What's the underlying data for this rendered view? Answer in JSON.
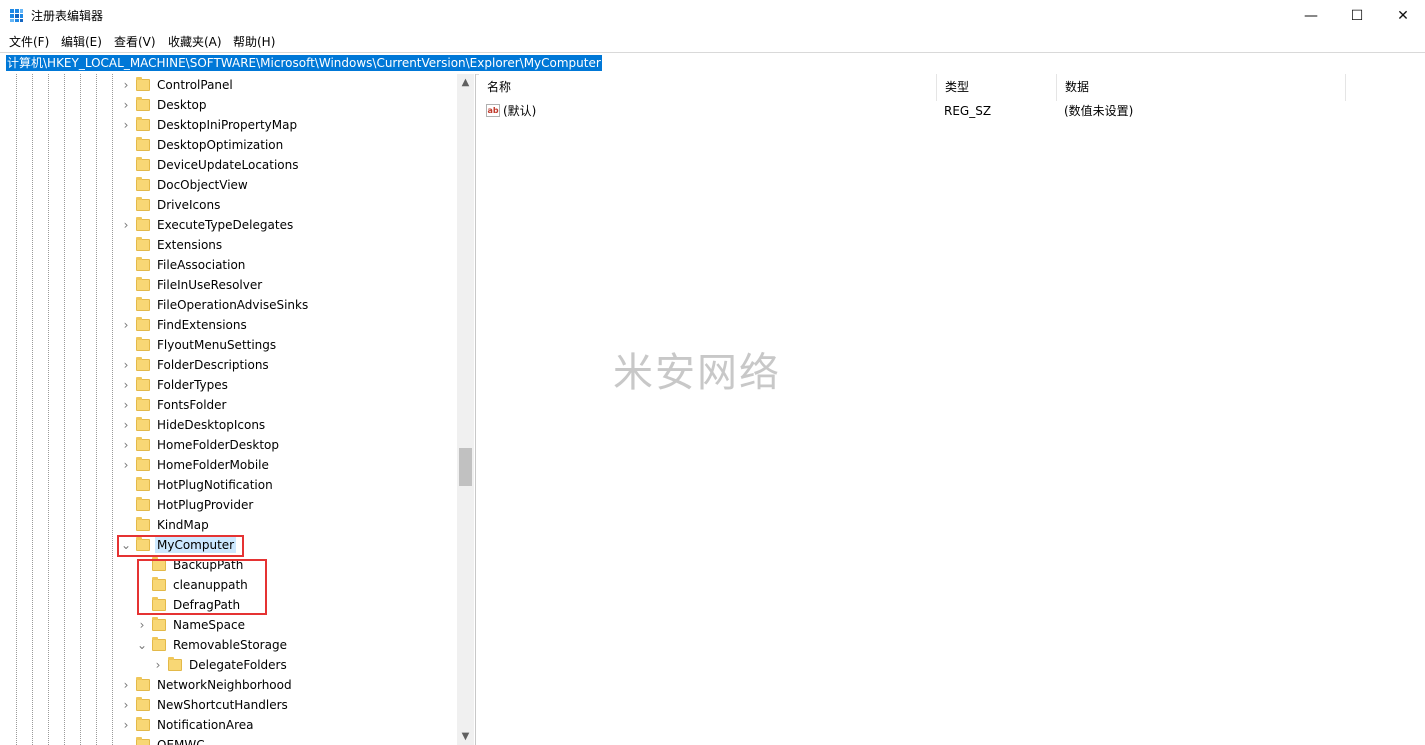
{
  "window": {
    "title": "注册表编辑器",
    "minimize": "—",
    "maximize": "☐",
    "close": "✕"
  },
  "menu": [
    "文件(F)",
    "编辑(E)",
    "查看(V)",
    "收藏夹(A)",
    "帮助(H)"
  ],
  "address": "计算机\\HKEY_LOCAL_MACHINE\\SOFTWARE\\Microsoft\\Windows\\CurrentVersion\\Explorer\\MyComputer",
  "tree": [
    {
      "label": "ControlPanel",
      "expander": "›"
    },
    {
      "label": "Desktop",
      "expander": "›"
    },
    {
      "label": "DesktopIniPropertyMap",
      "expander": "›"
    },
    {
      "label": "DesktopOptimization",
      "expander": ""
    },
    {
      "label": "DeviceUpdateLocations",
      "expander": ""
    },
    {
      "label": "DocObjectView",
      "expander": ""
    },
    {
      "label": "DriveIcons",
      "expander": ""
    },
    {
      "label": "ExecuteTypeDelegates",
      "expander": "›"
    },
    {
      "label": "Extensions",
      "expander": ""
    },
    {
      "label": "FileAssociation",
      "expander": ""
    },
    {
      "label": "FileInUseResolver",
      "expander": ""
    },
    {
      "label": "FileOperationAdviseSinks",
      "expander": ""
    },
    {
      "label": "FindExtensions",
      "expander": "›"
    },
    {
      "label": "FlyoutMenuSettings",
      "expander": ""
    },
    {
      "label": "FolderDescriptions",
      "expander": "›"
    },
    {
      "label": "FolderTypes",
      "expander": "›"
    },
    {
      "label": "FontsFolder",
      "expander": "›"
    },
    {
      "label": "HideDesktopIcons",
      "expander": "›"
    },
    {
      "label": "HomeFolderDesktop",
      "expander": "›"
    },
    {
      "label": "HomeFolderMobile",
      "expander": "›"
    },
    {
      "label": "HotPlugNotification",
      "expander": ""
    },
    {
      "label": "HotPlugProvider",
      "expander": ""
    },
    {
      "label": "KindMap",
      "expander": ""
    },
    {
      "label": "MyComputer",
      "expander": "⌄"
    },
    {
      "label": "BackupPath",
      "expander": ""
    },
    {
      "label": "cleanuppath",
      "expander": ""
    },
    {
      "label": "DefragPath",
      "expander": ""
    },
    {
      "label": "NameSpace",
      "expander": "›"
    },
    {
      "label": "RemovableStorage",
      "expander": "⌄"
    },
    {
      "label": "DelegateFolders",
      "expander": "›"
    },
    {
      "label": "NetworkNeighborhood",
      "expander": "›"
    },
    {
      "label": "NewShortcutHandlers",
      "expander": "›"
    },
    {
      "label": "NotificationArea",
      "expander": "›"
    },
    {
      "label": "OEMWC",
      "expander": ""
    }
  ],
  "columns": {
    "name": "名称",
    "type": "类型",
    "data": "数据"
  },
  "values": [
    {
      "name": "(默认)",
      "type": "REG_SZ",
      "data": "(数值未设置)",
      "icon": "ab"
    }
  ],
  "scroll": {
    "up": "▲",
    "down": "▼"
  },
  "watermark": "米安网络",
  "colors": {
    "selection": "#0078d7",
    "highlight_box": "#e53333",
    "folder": "#f8d775"
  }
}
